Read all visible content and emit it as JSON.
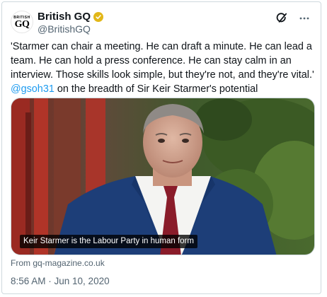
{
  "account": {
    "avatar_small_text": "BRITISH",
    "avatar_big_text": "GQ",
    "display_name": "British GQ",
    "handle": "@BritishGQ",
    "verified_color": "#e2b719"
  },
  "tweet": {
    "text_before_mention": "'Starmer can chair a meeting. He can draft a minute. He can lead a team. He can hold a press conference. He can stay calm in an interview. Those skills look simple, but they're not, and they're vital.' ",
    "mention": "@gsoh31",
    "text_after_mention": " on the breadth of Sir Keir Starmer's potential",
    "mention_color": "#1d9bf0"
  },
  "media": {
    "caption": "Keir Starmer is the Labour Party in human form"
  },
  "source": "From gq-magazine.co.uk",
  "timestamp": "8:56 AM · Jun 10, 2020",
  "icons": [
    "grok-icon",
    "more-icon",
    "verified-icon"
  ]
}
